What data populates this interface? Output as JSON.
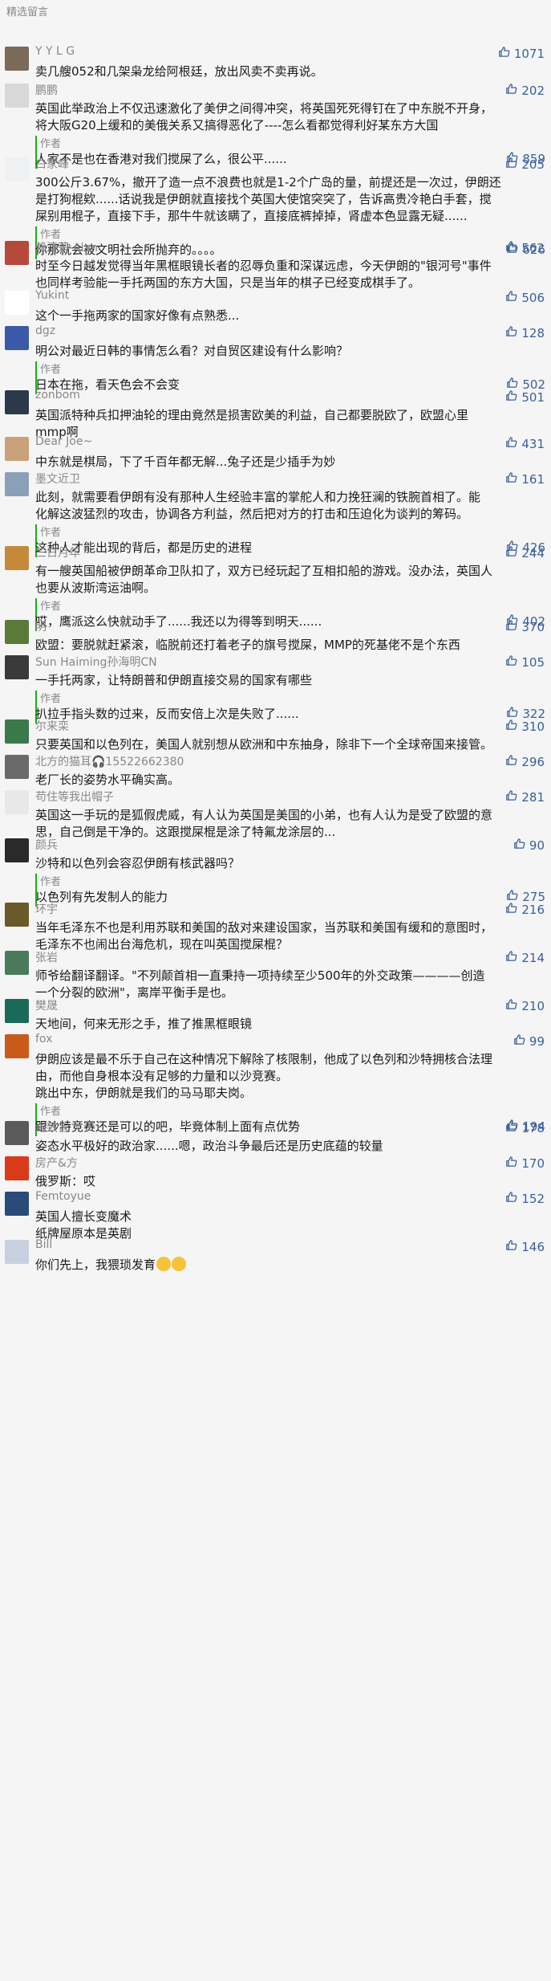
{
  "header": {
    "title": "精选留言"
  },
  "comments": [
    {
      "nick": "Y Y L G",
      "likes": "1071",
      "lines": [
        "卖几艘052和几架枭龙给阿根廷，放出风卖不卖再说。"
      ],
      "avatar_color": "#7a6a58"
    },
    {
      "nick": "鹏鹏",
      "likes": "202",
      "lines": [
        "英国此举政治上不仅迅速激化了美伊之间得冲突，将英国死死得钉在了中东脱不开身，",
        "将大阪G20上缓和的美俄关系又搞得恶化了----怎么看都觉得利好某东方大国"
      ],
      "reply": {
        "label": "作者",
        "likes": "859",
        "lines": [
          "人家不是也在香港对我们搅屎了么，很公平......"
        ]
      },
      "avatar_color": "#d8d8d8"
    },
    {
      "nick": "白家峰",
      "likes": "205",
      "lines": [
        "300公斤3.67%，撤开了造一点不浪费也就是1-2个广岛的量，前提还是一次过，伊朗还",
        "是打狗棍欸......话说我是伊朗就直接找个英国大使馆突突了，告诉高贵冷艳白手套，搅",
        "屎别用棍子，直接下手，那牛牛就该瞒了，直接底裤掉掉，肾虚本色显露无疑......"
      ],
      "reply": {
        "label": "作者",
        "likes": "626",
        "lines": [
          "你那就会被文明社会所抛弃的。。。。"
        ]
      },
      "avatar_color": "#eef0f2"
    },
    {
      "nick": "赖清荣-Alan",
      "likes": "562",
      "lines": [
        "时至今日越发觉得当年黑框眼镜长者的忍辱负重和深谋远虑，今天伊朗的\"银河号\"事件",
        "也同样考验能一手托两国的东方大国，只是当年的棋子已经变成棋手了。"
      ],
      "avatar_color": "#b54a3a"
    },
    {
      "nick": "Yukint",
      "likes": "506",
      "lines": [
        "这个一手拖两家的国家好像有点熟悉..."
      ],
      "avatar_color": "#ffffff"
    },
    {
      "nick": "dgz",
      "likes": "128",
      "lines": [
        "明公对最近日韩的事情怎么看？对自贸区建设有什么影响？"
      ],
      "reply": {
        "label": "作者",
        "likes": "502",
        "lines": [
          "日本在拖，看天色会不会变"
        ]
      },
      "avatar_color": "#3a5aa8"
    },
    {
      "nick": "zonbom",
      "likes": "501",
      "lines": [
        "英国派特种兵扣押油轮的理由竟然是损害欧美的利益，自己都要脱欧了，欧盟心里",
        "mmp啊"
      ],
      "avatar_color": "#2a3a4a"
    },
    {
      "nick": "Dear Joe~",
      "likes": "431",
      "lines": [
        "中东就是棋局，下了千百年都无解...兔子还是少插手为妙"
      ],
      "avatar_color": "#c9a27a"
    },
    {
      "nick": "墨文近卫",
      "likes": "161",
      "lines": [
        "此刻，就需要看伊朗有没有那种人生经验丰富的掌舵人和力挽狂澜的铁腕首相了。能",
        "化解这波猛烈的攻击，协调各方利益，然后把对方的打击和压迫化为谈判的筹码。"
      ],
      "reply": {
        "label": "作者",
        "likes": "426",
        "lines": [
          "这种人才能出现的背后，都是历史的进程"
        ]
      },
      "avatar_color": "#8aa0b8"
    },
    {
      "nick": "三日月年",
      "likes": "244",
      "lines": [
        "有一艘英国船被伊朗革命卫队扣了，双方已经玩起了互相扣船的游戏。没办法，英国人",
        "也要从波斯湾运油啊。"
      ],
      "reply": {
        "label": "作者",
        "likes": "402",
        "lines": [
          "哎，鹰派这么快就动手了......我还以为得等到明天......"
        ]
      },
      "avatar_color": "#c48a3a"
    },
    {
      "nick": "明",
      "likes": "370",
      "lines": [
        "欧盟：要脱就赶紧滚，临脱前还打着老子的旗号搅屎，MMP的死基佬不是个东西"
      ],
      "avatar_color": "#5a7a3a"
    },
    {
      "nick": "Sun Haiming孙海明CN",
      "likes": "105",
      "lines": [
        "一手托两家，让特朗普和伊朗直接交易的国家有哪些"
      ],
      "reply": {
        "label": "作者",
        "likes": "322",
        "lines": [
          "扒拉手指头数的过来，反而安倍上次是失败了......"
        ]
      },
      "avatar_color": "#3a3a3a"
    },
    {
      "nick": "尔来栾",
      "likes": "310",
      "lines": [
        "只要英国和以色列在，美国人就别想从欧洲和中东抽身，除非下一个全球帝国来接管。"
      ],
      "avatar_color": "#3a7a4a"
    },
    {
      "nick": "北方的猫耳🎧15522662380",
      "likes": "296",
      "lines": [
        "老厂长的姿势水平确实高。"
      ],
      "avatar_color": "#6a6a6a"
    },
    {
      "nick": "苟住等我出帽子",
      "likes": "281",
      "lines": [
        "英国这一手玩的是狐假虎威，有人认为英国是美国的小弟，也有人认为是受了欧盟的意",
        "思，自己倒是干净的。这跟搅屎棍是涂了特氟龙涂层的..."
      ],
      "avatar_color": "#e8e8e8"
    },
    {
      "nick": "颜兵",
      "likes": "90",
      "lines": [
        "沙特和以色列会容忍伊朗有核武器吗？"
      ],
      "reply": {
        "label": "作者",
        "likes": "275",
        "lines": [
          "以色列有先发制人的能力"
        ]
      },
      "avatar_color": "#2a2a2a"
    },
    {
      "nick": "环宇",
      "likes": "216",
      "lines": [
        "当年毛泽东不也是利用苏联和美国的敌对来建设国家，当苏联和美国有缓和的意图时，",
        "毛泽东不也闹出台海危机，现在叫英国搅屎棍？"
      ],
      "avatar_color": "#6a5a2a"
    },
    {
      "nick": "张岩",
      "likes": "214",
      "lines": [
        "师爷给翻译翻译。\"不列颠首相一直秉持一项持续至少500年的外交政策————创造",
        "一个分裂的欧洲\"，离岸平衡手是也。"
      ],
      "avatar_color": "#4a7a5a"
    },
    {
      "nick": "樊晟",
      "likes": "210",
      "lines": [
        "天地间，何来无形之手，推了推黑框眼镜"
      ],
      "avatar_color": "#1a6a5a"
    },
    {
      "nick": "fox",
      "likes": "99",
      "lines": [
        "伊朗应该是最不乐于自己在这种情况下解除了核限制，他成了以色列和沙特拥核合法理",
        "由，而他自身根本没有足够的力量和以沙竞赛。",
        "跳出中东，伊朗就是我们的马马耶夫岗。"
      ],
      "reply": {
        "label": "作者",
        "likes": "194",
        "lines": [
          "跟沙特竞赛还是可以的吧，毕竟体制上面有点优势"
        ]
      },
      "avatar_color": "#c85a1a"
    },
    {
      "nick": "周致言",
      "likes": "178",
      "lines": [
        "姿态水平极好的政治家......嗯，政治斗争最后还是历史底蕴的较量"
      ],
      "avatar_color": "#5a5a5a"
    },
    {
      "nick": "房产&方",
      "likes": "170",
      "lines": [
        "俄罗斯：哎"
      ],
      "avatar_color": "#d83a1a"
    },
    {
      "nick": "Femtoyue",
      "likes": "152",
      "lines": [
        "英国人擅长变魔术",
        "纸牌屋原本是英剧"
      ],
      "avatar_color": "#2a4a7a"
    },
    {
      "nick": "Bill",
      "likes": "146",
      "lines": [
        "你们先上，我猥琐发育"
      ],
      "emoji_count": 2,
      "avatar_color": "#c8d0e0"
    }
  ]
}
